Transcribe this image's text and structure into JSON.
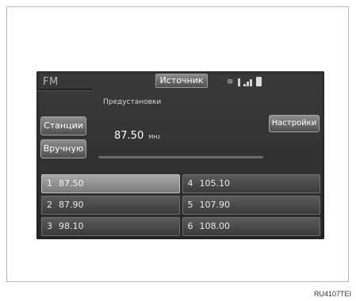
{
  "header": {
    "mode": "FM",
    "source_button": "Источник"
  },
  "status_icons": [
    "wifi-icon",
    "bluetooth-icon",
    "signal-icon",
    "battery-icon"
  ],
  "presets_title": "Предустановки",
  "buttons": {
    "stations": "Станции",
    "manual": "Вручную",
    "settings": "Настройки"
  },
  "current": {
    "frequency": "87.50",
    "unit": "MHz"
  },
  "presets": [
    {
      "number": "1",
      "frequency": "87.50",
      "active": true
    },
    {
      "number": "4",
      "frequency": "105.10",
      "active": false
    },
    {
      "number": "2",
      "frequency": "87.90",
      "active": false
    },
    {
      "number": "5",
      "frequency": "107.90",
      "active": false
    },
    {
      "number": "3",
      "frequency": "98.10",
      "active": false
    },
    {
      "number": "6",
      "frequency": "108.00",
      "active": false
    }
  ],
  "caption": "RU4107TEI"
}
